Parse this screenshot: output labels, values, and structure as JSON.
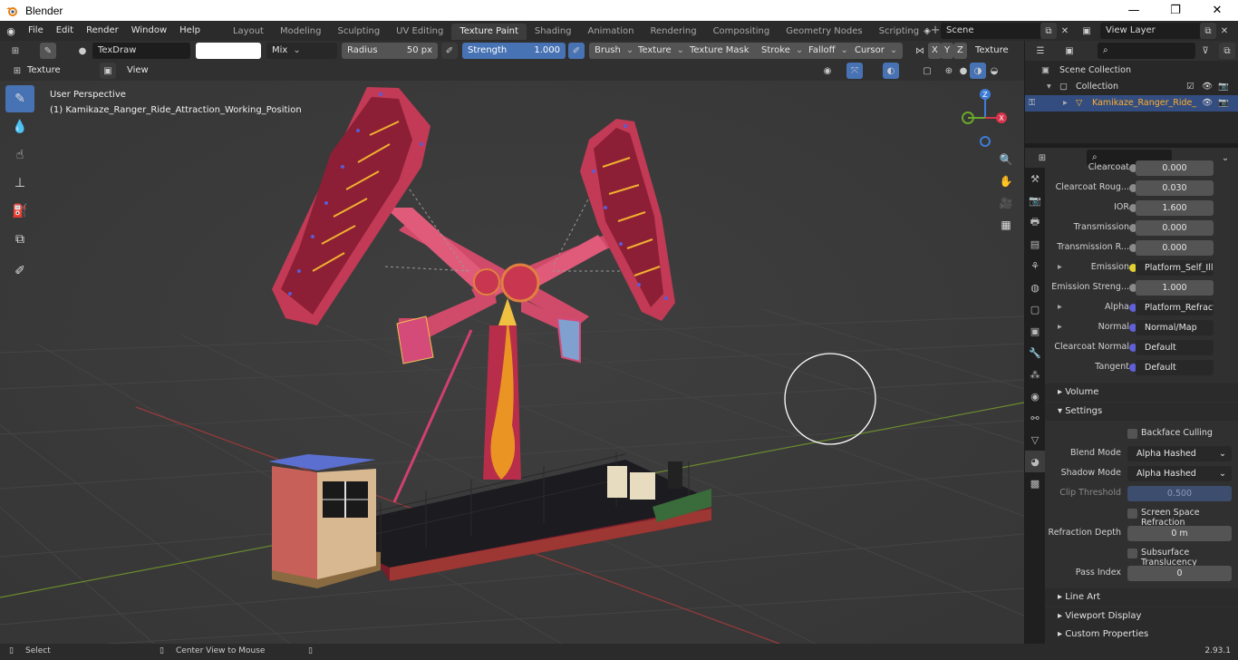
{
  "window": {
    "title": "Blender",
    "minimize": "—",
    "maximize": "❐",
    "close": "✕"
  },
  "menu": [
    "File",
    "Edit",
    "Render",
    "Window",
    "Help"
  ],
  "workspaces": [
    "Layout",
    "Modeling",
    "Sculpting",
    "UV Editing",
    "Texture Paint",
    "Shading",
    "Animation",
    "Rendering",
    "Compositing",
    "Geometry Nodes",
    "Scripting"
  ],
  "active_workspace": "Texture Paint",
  "scene": {
    "name": "Scene",
    "view_layer": "View Layer"
  },
  "toolbar": {
    "brush_name": "TexDraw",
    "blend": "Mix",
    "radius_label": "Radius",
    "radius_value": "50 px",
    "strength_label": "Strength",
    "strength_value": "1.000",
    "menus": [
      "Brush",
      "Texture",
      "Texture Mask",
      "Stroke",
      "Falloff",
      "Cursor"
    ],
    "axes": [
      "X",
      "Y",
      "Z"
    ],
    "texture_slots": "Texture Slots"
  },
  "modebar": {
    "mode": "Texture Paint",
    "view": "View"
  },
  "viewport": {
    "perspective": "User Perspective",
    "object_label": "(1) Kamikaze_Ranger_Ride_Attraction_Working_Position",
    "gizmo": {
      "x": "X",
      "y": "Y",
      "z": "Z"
    }
  },
  "outliner": {
    "scene_collection": "Scene Collection",
    "collection": "Collection",
    "object": "Kamikaze_Ranger_Ride_"
  },
  "properties": {
    "rows": [
      {
        "label": "Clearcoat",
        "value": "0.000",
        "type": "num"
      },
      {
        "label": "Clearcoat Roug...",
        "value": "0.030",
        "type": "num"
      },
      {
        "label": "IOR",
        "value": "1.600",
        "type": "num"
      },
      {
        "label": "Transmission",
        "value": "0.000",
        "type": "num"
      },
      {
        "label": "Transmission R...",
        "value": "0.000",
        "type": "num"
      },
      {
        "label": "Emission",
        "value": "Platform_Self_Illum.p...",
        "type": "link"
      },
      {
        "label": "Emission Streng...",
        "value": "1.000",
        "type": "num"
      },
      {
        "label": "Alpha",
        "value": "Platform_Refraction...",
        "type": "link"
      },
      {
        "label": "Normal",
        "value": "Normal/Map",
        "type": "link"
      },
      {
        "label": "Clearcoat Normal",
        "value": "Default",
        "type": "link"
      },
      {
        "label": "Tangent",
        "value": "Default",
        "type": "link"
      }
    ],
    "sections": {
      "volume": "Volume",
      "settings": "Settings",
      "line_art": "Line Art",
      "viewport_display": "Viewport Display",
      "custom_properties": "Custom Properties"
    },
    "settings": {
      "backface_culling": "Backface Culling",
      "blend_mode_label": "Blend Mode",
      "blend_mode": "Alpha Hashed",
      "shadow_mode_label": "Shadow Mode",
      "shadow_mode": "Alpha Hashed",
      "clip_threshold_label": "Clip Threshold",
      "clip_threshold": "0.500",
      "ssr": "Screen Space Refraction",
      "refraction_depth_label": "Refraction Depth",
      "refraction_depth": "0 m",
      "subsurface_translucency": "Subsurface Translucency",
      "pass_index_label": "Pass Index",
      "pass_index": "0"
    }
  },
  "statusbar": {
    "left": "Select",
    "middle": "Center View to Mouse",
    "version": "2.93.1"
  },
  "colors": {
    "accent": "#4772b3",
    "selected_text": "#ffaf29",
    "ride_red": "#c8364f"
  }
}
